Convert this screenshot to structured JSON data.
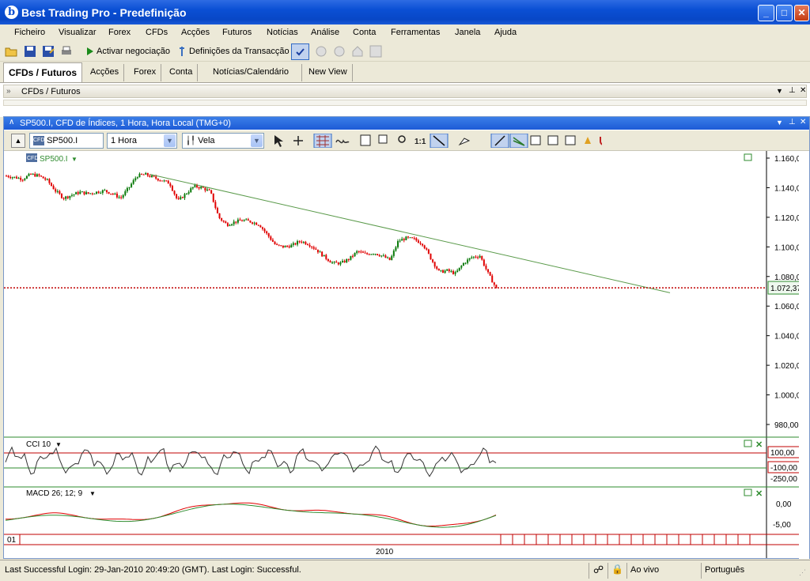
{
  "window": {
    "title": "Best Trading Pro - Predefinição",
    "app_icon": "b"
  },
  "menu": [
    "Ficheiro",
    "Visualizar",
    "Forex",
    "CFDs",
    "Acções",
    "Futuros",
    "Notícias",
    "Análise",
    "Conta",
    "Ferramentas",
    "Janela",
    "Ajuda"
  ],
  "toolbar": {
    "activate": "Activar negociação",
    "settings": "Definições da Transacção"
  },
  "tabs": {
    "active": "CFDs / Futuros",
    "items": [
      "Acções",
      "Forex",
      "Conta",
      "Notícias/Calendário",
      "New View"
    ]
  },
  "panel": {
    "title": "CFDs / Futuros"
  },
  "chart_window": {
    "title": "SP500.I, CFD de Índices, 1 Hora, Hora Local (TMG+0)",
    "symbol": "SP500.I",
    "timeframe": "1 Hora",
    "chart_style": "Vela",
    "price_label": "SP500.I",
    "symbol_badge": "CFD",
    "current_price": "1.072,37",
    "y_ticks": [
      "1.160,00",
      "1.140,00",
      "1.120,00",
      "1.100,00",
      "1.080,00",
      "1.060,00",
      "1.040,00",
      "1.020,00",
      "1.000,00",
      "980,00"
    ],
    "cci_label": "CCI 10",
    "cci_ticks": [
      "100,00",
      "-100,00",
      "-250,00"
    ],
    "macd_label": "MACD 26; 12; 9",
    "macd_ticks": [
      "0,00",
      "-5,00"
    ],
    "date_label_left": "01",
    "year_label": "2010"
  },
  "chart_data": {
    "type": "candlestick",
    "title": "SP500.I, CFD de Índices, 1 Hora, Hora Local (TMG+0)",
    "ylim": [
      970,
      1165
    ],
    "last_price": 1072.37,
    "price_path": [
      1148,
      1147,
      1146,
      1149,
      1148,
      1145,
      1138,
      1133,
      1135,
      1137,
      1136,
      1137,
      1138,
      1136,
      1133,
      1140,
      1148,
      1149,
      1147,
      1145,
      1143,
      1131,
      1136,
      1141,
      1140,
      1137,
      1120,
      1115,
      1117,
      1118,
      1117,
      1115,
      1108,
      1101,
      1100,
      1101,
      1104,
      1102,
      1098,
      1093,
      1089,
      1089,
      1092,
      1097,
      1095,
      1096,
      1094,
      1091,
      1104,
      1106,
      1105,
      1102,
      1092,
      1083,
      1084,
      1082,
      1089,
      1093,
      1094,
      1082,
      1072
    ],
    "trendline": {
      "start": 1149,
      "end": 1069
    },
    "cci": {
      "label": "CCI 10",
      "levels": [
        100,
        -100
      ]
    },
    "macd": {
      "label": "MACD 26; 12; 9"
    },
    "colors": {
      "up": "#0a7a0a",
      "down": "#e00000",
      "last_price": "#c00000",
      "trend": "#5a9a4a"
    }
  },
  "status": {
    "login": "Last Successful Login: 29-Jan-2010 20:49:20 (GMT). Last Login: Successful.",
    "mode": "Ao vivo",
    "language": "Português"
  }
}
